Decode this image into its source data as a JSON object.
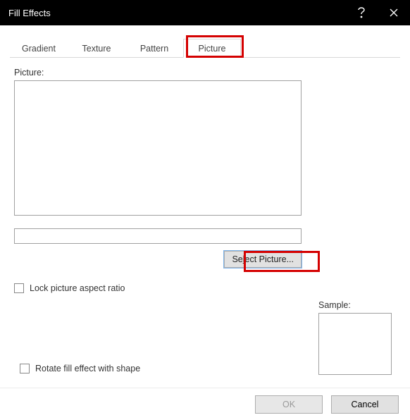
{
  "titlebar": {
    "title": "Fill Effects"
  },
  "tabs": {
    "items": [
      {
        "label": "Gradient"
      },
      {
        "label": "Texture"
      },
      {
        "label": "Pattern"
      },
      {
        "label": "Picture"
      }
    ],
    "active_index": 3
  },
  "picture": {
    "label": "Picture:",
    "path_value": "",
    "select_pre": "Se",
    "select_u": "l",
    "select_post": "ect Picture...",
    "lock_label": "Lock picture aspect ratio"
  },
  "sample": {
    "label": "Sample:"
  },
  "rotate": {
    "label": "Rotate fill effect with shape"
  },
  "footer": {
    "ok": "OK",
    "cancel": "Cancel"
  }
}
